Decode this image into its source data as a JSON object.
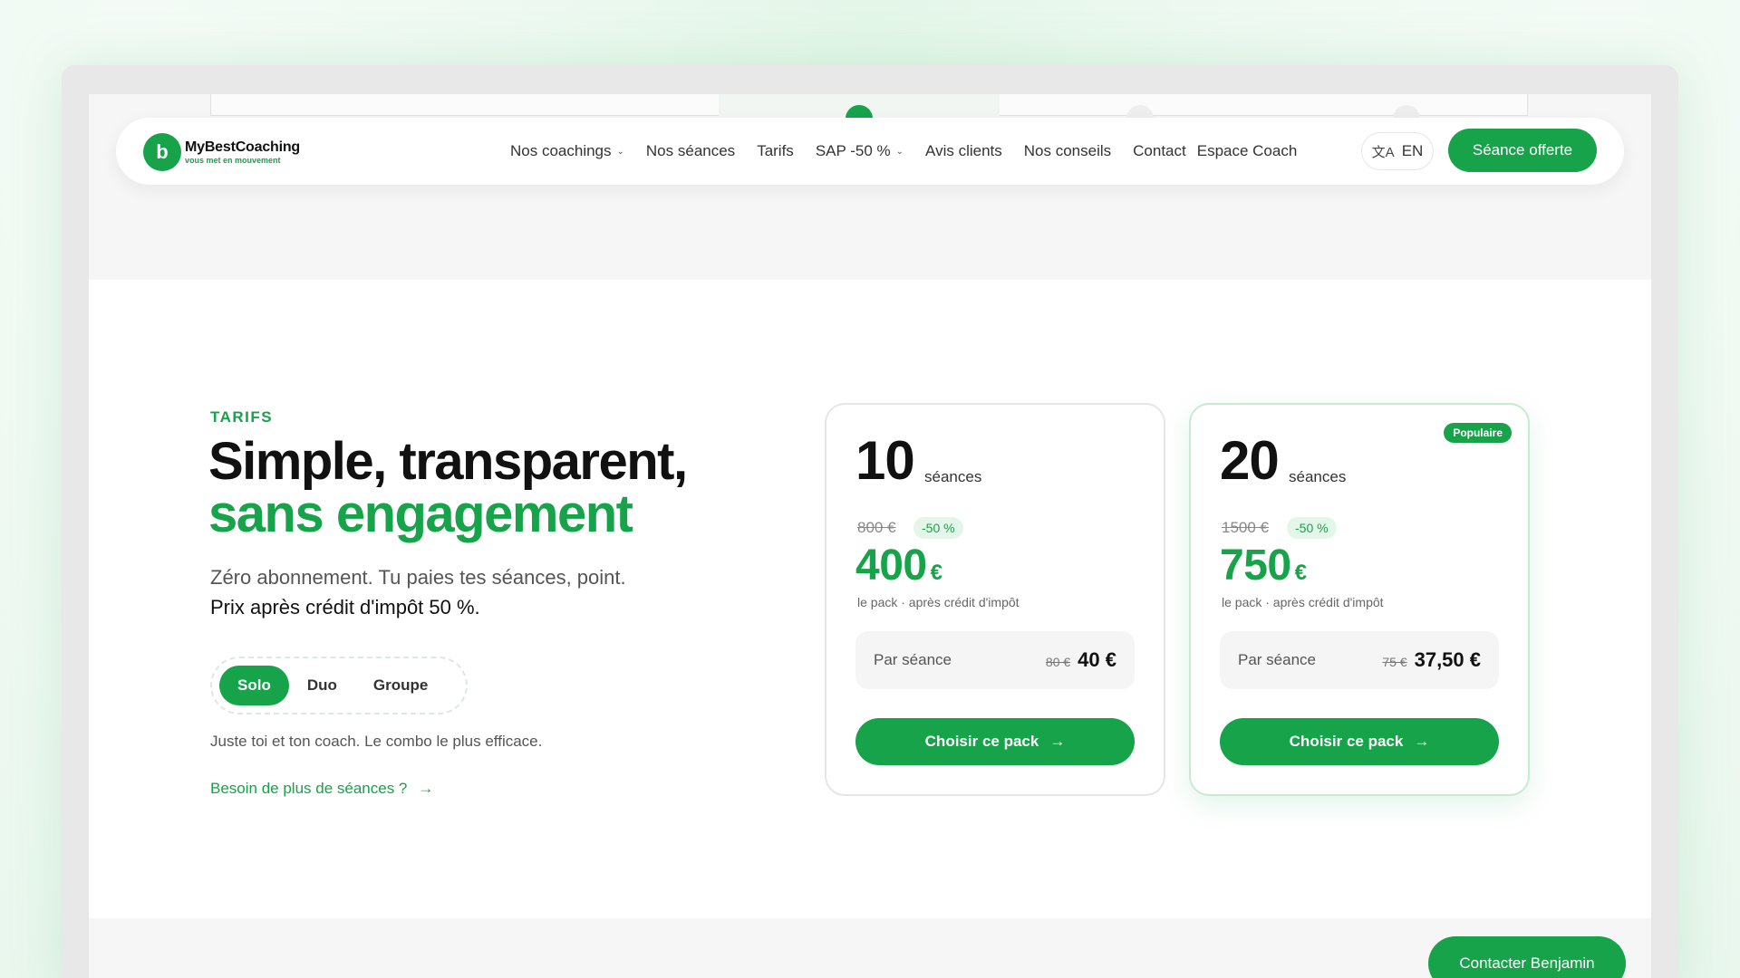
{
  "nav": {
    "logo_letter": "b",
    "brand": "MyBestCoaching",
    "tagline": "vous met en mouvement",
    "links": [
      {
        "label": "Nos coachings",
        "dropdown": true
      },
      {
        "label": "Nos séances",
        "dropdown": false
      },
      {
        "label": "Tarifs",
        "dropdown": false
      },
      {
        "label": "SAP -50 %",
        "dropdown": true
      },
      {
        "label": "Avis clients",
        "dropdown": false
      },
      {
        "label": "Nos conseils",
        "dropdown": false
      },
      {
        "label": "Contact",
        "dropdown": false
      },
      {
        "label": "Espace Coach",
        "dropdown": false
      }
    ],
    "language": "EN",
    "cta": "Séance offerte"
  },
  "pricing": {
    "eyebrow": "TARIFS",
    "title_line1": "Simple, transparent,",
    "title_line2": "sans engagement",
    "lead_plain": "Zéro abonnement. Tu paies tes séances, point. ",
    "lead_bold": "Prix après crédit d'impôt 50 %.",
    "toggle": [
      "Solo",
      "Duo",
      "Groupe"
    ],
    "toggle_selected": "Solo",
    "hint": "Juste toi et ton coach. Le combo le plus efficace.",
    "more_link": "Besoin de plus de séances ?",
    "cards": [
      {
        "count": "10",
        "count_label": "séances",
        "old_price": "800 €",
        "discount": "-50 %",
        "price": "400",
        "currency": "€",
        "price_sub": "le pack · après crédit d'impôt",
        "per_label": "Par séance",
        "per_old": "80 €",
        "per_new": "40 €",
        "button": "Choisir ce pack",
        "badge": ""
      },
      {
        "count": "20",
        "count_label": "séances",
        "old_price": "1500 €",
        "discount": "-50 %",
        "price": "750",
        "currency": "€",
        "price_sub": "le pack · après crédit d'impôt",
        "per_label": "Par séance",
        "per_old": "75 €",
        "per_new": "37,50 €",
        "button": "Choisir ce pack",
        "badge": "Populaire"
      }
    ]
  },
  "floating_button": "Contacter Benjamin",
  "colors": {
    "accent": "#16a349",
    "accent_light": "#e4f5e9"
  }
}
